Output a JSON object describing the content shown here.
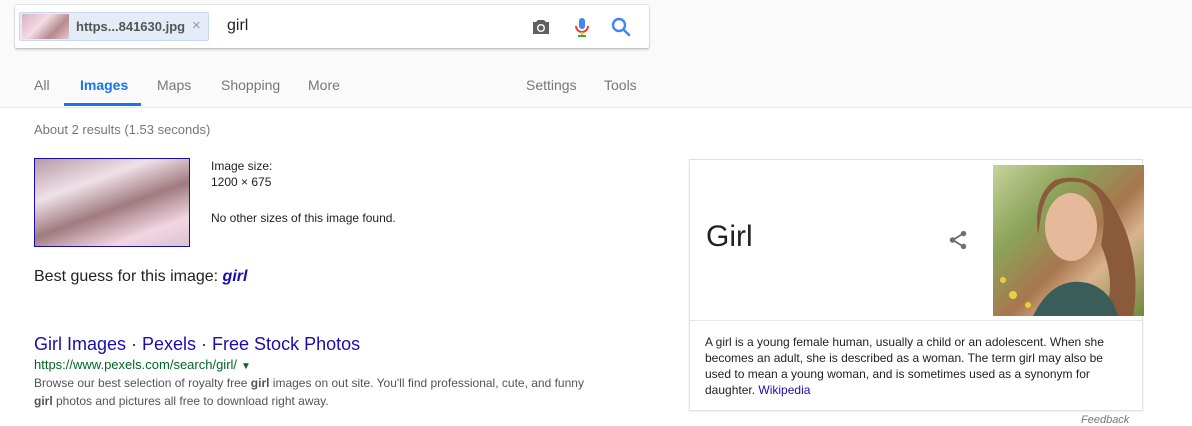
{
  "search": {
    "chip_label": "https...841630.jpg",
    "chip_close": "×",
    "query": "girl"
  },
  "tabs": {
    "all": "All",
    "images": "Images",
    "maps": "Maps",
    "shopping": "Shopping",
    "more": "More",
    "settings": "Settings",
    "tools": "Tools"
  },
  "stats": "About 2 results (1.53 seconds)",
  "image_info": {
    "size_label": "Image size:",
    "size_value": "1200 × 675",
    "other_sizes": "No other sizes of this image found."
  },
  "best_guess": {
    "prefix": "Best guess for this image:",
    "query": "girl"
  },
  "result": {
    "title": "Girl Images · Pexels · Free Stock Photos",
    "url": "https://www.pexels.com/search/girl/",
    "url_caret": "▼",
    "snippet_1": "Browse our best selection of royalty free ",
    "snippet_bold1": "girl",
    "snippet_2": " images on out site. You'll find professional, cute, and funny ",
    "snippet_bold2": "girl",
    "snippet_3": " photos and pictures all free to download right away."
  },
  "knowledge_panel": {
    "title": "Girl",
    "description": "A girl is a young female human, usually a child or an adolescent. When she becomes an adult, she is described as a woman. The term girl may also be used to mean a young woman, and is sometimes used as a synonym for daughter.",
    "source_link": "Wikipedia"
  },
  "feedback": "Feedback",
  "colors": {
    "accent": "#1a73e8",
    "link": "#1a0dab",
    "url_green": "#006621"
  },
  "icons": [
    "camera-icon",
    "microphone-icon",
    "search-icon",
    "share-icon",
    "close-icon",
    "caret-down-icon"
  ]
}
